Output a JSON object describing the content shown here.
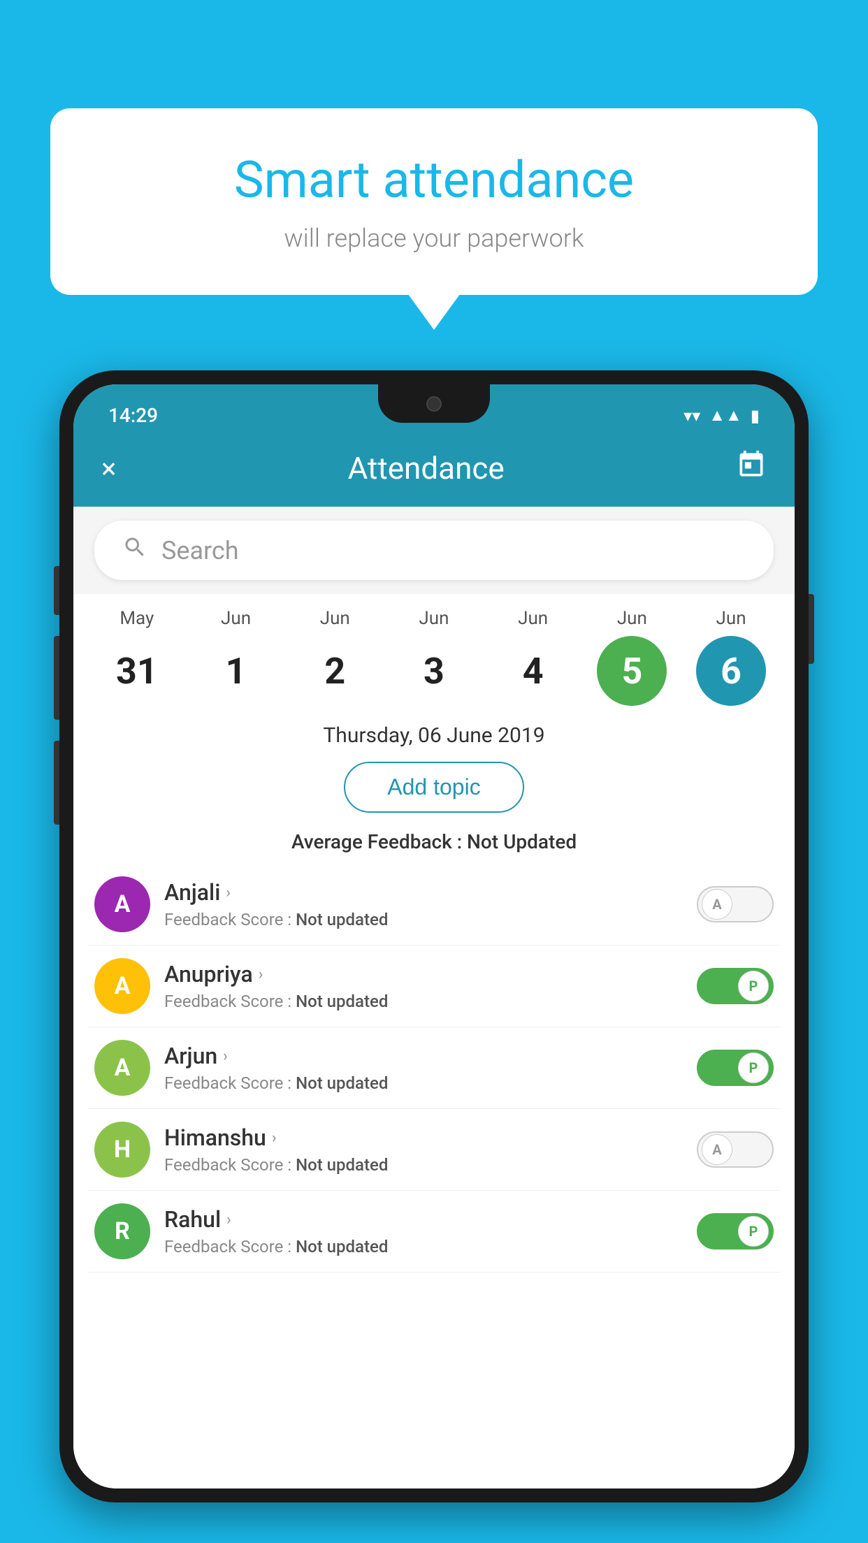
{
  "background_color": "#1ab8e8",
  "speech_bubble": {
    "title": "Smart attendance",
    "subtitle": "will replace your paperwork"
  },
  "status_bar": {
    "time": "14:29",
    "wifi": "▼",
    "signal": "▲",
    "battery": "▮"
  },
  "app_bar": {
    "title": "Attendance",
    "close_label": "×",
    "calendar_label": "📅"
  },
  "search": {
    "placeholder": "Search"
  },
  "calendar": {
    "days": [
      {
        "month": "May",
        "date": "31",
        "style": "normal"
      },
      {
        "month": "Jun",
        "date": "1",
        "style": "normal"
      },
      {
        "month": "Jun",
        "date": "2",
        "style": "normal"
      },
      {
        "month": "Jun",
        "date": "3",
        "style": "normal"
      },
      {
        "month": "Jun",
        "date": "4",
        "style": "normal"
      },
      {
        "month": "Jun",
        "date": "5",
        "style": "today"
      },
      {
        "month": "Jun",
        "date": "6",
        "style": "selected"
      }
    ],
    "selected_date_label": "Thursday, 06 June 2019"
  },
  "add_topic_label": "Add topic",
  "avg_feedback_label": "Average Feedback :",
  "avg_feedback_value": "Not Updated",
  "students": [
    {
      "name": "Anjali",
      "avatar_letter": "A",
      "avatar_color": "#9c27b0",
      "feedback_label": "Feedback Score :",
      "feedback_value": "Not updated",
      "toggle": "off",
      "toggle_letter": "A"
    },
    {
      "name": "Anupriya",
      "avatar_letter": "A",
      "avatar_color": "#ffc107",
      "feedback_label": "Feedback Score :",
      "feedback_value": "Not updated",
      "toggle": "on",
      "toggle_letter": "P"
    },
    {
      "name": "Arjun",
      "avatar_letter": "A",
      "avatar_color": "#8bc34a",
      "feedback_label": "Feedback Score :",
      "feedback_value": "Not updated",
      "toggle": "on",
      "toggle_letter": "P"
    },
    {
      "name": "Himanshu",
      "avatar_letter": "H",
      "avatar_color": "#8bc34a",
      "feedback_label": "Feedback Score :",
      "feedback_value": "Not updated",
      "toggle": "off",
      "toggle_letter": "A"
    },
    {
      "name": "Rahul",
      "avatar_letter": "R",
      "avatar_color": "#4caf50",
      "feedback_label": "Feedback Score :",
      "feedback_value": "Not updated",
      "toggle": "on",
      "toggle_letter": "P"
    }
  ]
}
